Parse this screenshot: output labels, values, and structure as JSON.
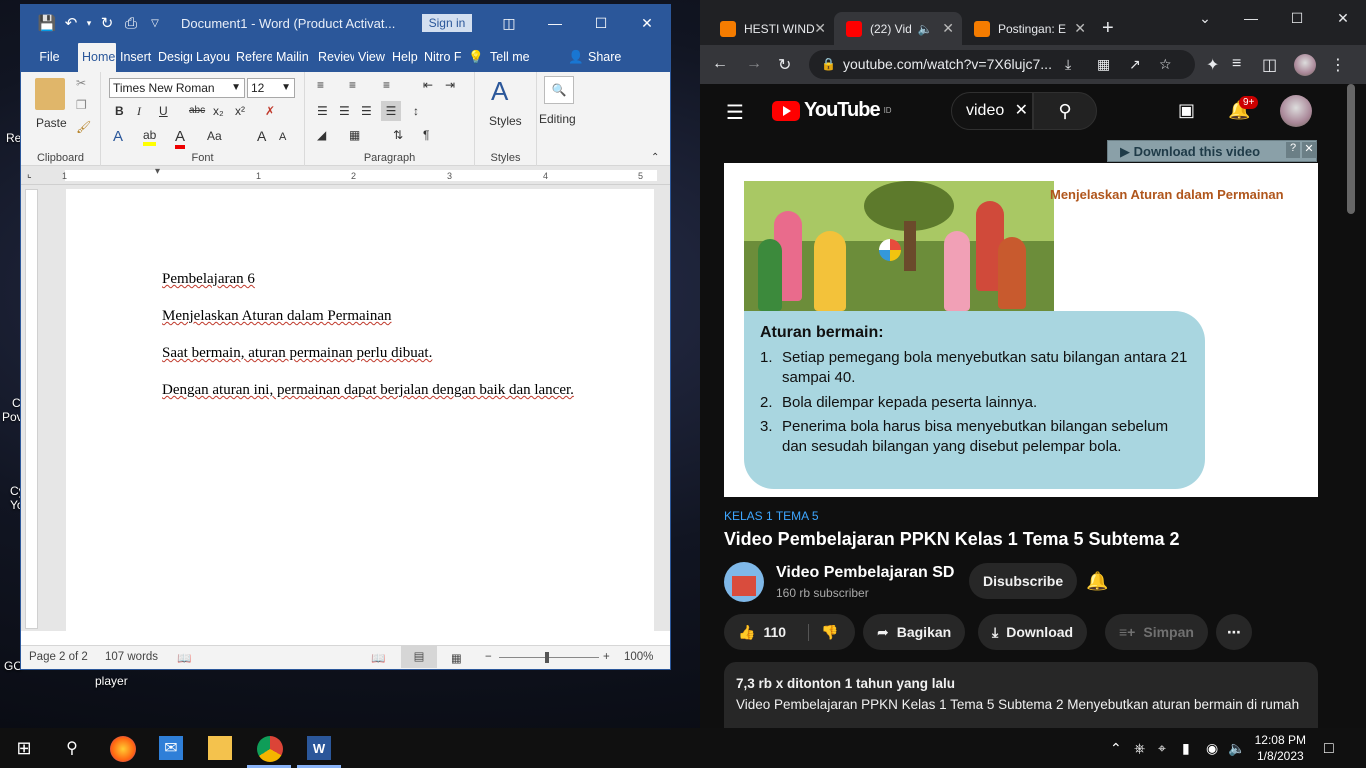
{
  "desktop": {
    "labels": [
      "Re",
      "C",
      "Pov",
      "Cy",
      "Yo",
      "GO",
      "player"
    ]
  },
  "word": {
    "title": "Document1  -  Word (Product Activat...",
    "sign_in": "Sign in",
    "tabs": [
      "File",
      "Home",
      "Insert",
      "Desigr",
      "Layou",
      "Refere",
      "Mailin",
      "Review",
      "View",
      "Help",
      "Nitro F"
    ],
    "tell_me": "Tell me",
    "share": "Share",
    "ribbon": {
      "paste": "Paste",
      "clipboard": "Clipboard",
      "font_name": "Times New Roman",
      "font_size": "12",
      "font": "Font",
      "paragraph": "Paragraph",
      "styles_btn": "Styles",
      "styles": "Styles",
      "editing": "Editing",
      "bold": "B",
      "italic": "I",
      "underline": "U",
      "strike": "abc",
      "subscript": "x₂",
      "superscript": "x²",
      "change_case": "Aa",
      "grow": "A",
      "shrink": "A",
      "pilcrow": "¶"
    },
    "ruler_ticks": [
      "1",
      "1",
      "2",
      "3",
      "4",
      "5"
    ],
    "document": {
      "paragraphs": [
        "Pembelajaran 6",
        "Menjelaskan Aturan dalam Permainan",
        "Saat bermain, aturan permainan perlu dibuat.",
        "Dengan aturan ini, permainan dapat berjalan dengan baik dan lancer."
      ]
    },
    "status": {
      "page": "Page 2 of 2",
      "words": "107 words",
      "zoom": "100%",
      "zoom_minus": "−",
      "zoom_plus": "+"
    }
  },
  "chrome": {
    "tabs": [
      {
        "title": "HESTI WIND",
        "favicon_color": "#f57c00"
      },
      {
        "title": "(22) Vid",
        "favicon_color": "#ff0000"
      },
      {
        "title": "Postingan: E",
        "favicon_color": "#f57c00"
      }
    ],
    "url": "youtube.com/watch?v=7X6lujc7..."
  },
  "youtube": {
    "logo": "YouTube",
    "region": "ID",
    "search_value": "video",
    "notifications": "9+",
    "download_bar": "Download this video",
    "video_frame": {
      "title": "Menjelaskan Aturan dalam Permainan",
      "rules_heading": "Aturan bermain:",
      "rules": [
        {
          "n": "1.",
          "text": "Setiap pemegang bola menyebutkan satu bilangan antara 21 sampai 40."
        },
        {
          "n": "2.",
          "text": "Bola dilempar kepada peserta lainnya."
        },
        {
          "n": "3.",
          "text": "Penerima bola harus bisa menyebutkan bilangan sebelum dan sesudah bilangan yang disebut pelempar bola."
        }
      ]
    },
    "hashtag": "KELAS 1 TEMA 5",
    "video_title": "Video Pembelajaran PPKN Kelas 1 Tema 5 Subtema 2",
    "channel": "Video Pembelajaran SD",
    "subscribers": "160 rb subscriber",
    "subscribe": "Disubscribe",
    "likes": "110",
    "share": "Bagikan",
    "download": "Download",
    "save": "Simpan",
    "views": "7,3 rb x ditonton  1 tahun yang lalu",
    "description": "Video Pembelajaran PPKN Kelas 1 Tema 5 Subtema 2 Menyebutkan aturan bermain di rumah"
  },
  "taskbar": {
    "time": "12:08 PM",
    "date": "1/8/2023"
  },
  "colors": {
    "word_blue": "#2b579a",
    "yt_red": "#ff0000",
    "yt_bg": "#0f0f0f",
    "video_title_orange": "#b0561c",
    "rules_box": "#a9d6e0"
  }
}
